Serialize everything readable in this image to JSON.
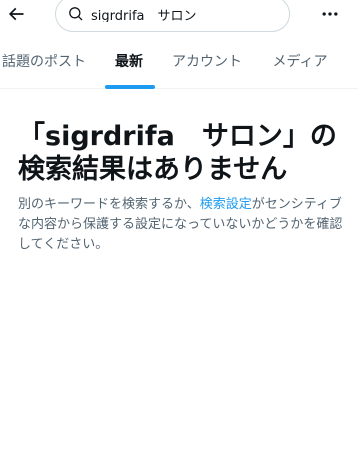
{
  "search": {
    "query": "sigrdrifa　サロン"
  },
  "tabs": [
    {
      "label": "話題のポスト"
    },
    {
      "label": "最新"
    },
    {
      "label": "アカウント"
    },
    {
      "label": "メディア"
    }
  ],
  "active_tab_index": 1,
  "empty": {
    "title": "「sigrdrifa　サロン」の検索結果はありません",
    "desc_before": "別のキーワードを検索するか、",
    "desc_link": "検索設定",
    "desc_after": "がセンシティブな内容から保護する設定になっていないかどうかを確認してください。"
  },
  "colors": {
    "accent": "#1d9bf0",
    "text_primary": "#0f1419",
    "text_secondary": "#536471",
    "border": "#cfd9de"
  },
  "icons": {
    "back": "arrow-left-icon",
    "search": "search-icon",
    "more": "more-horizontal-icon"
  }
}
